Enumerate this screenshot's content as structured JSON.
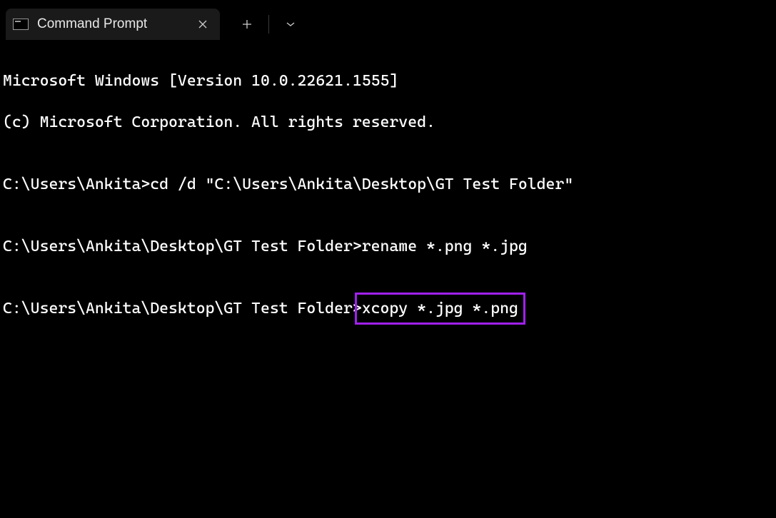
{
  "tab": {
    "title": "Command Prompt"
  },
  "terminal": {
    "line1": "Microsoft Windows [Version 10.0.22621.1555]",
    "line2": "(c) Microsoft Corporation. All rights reserved.",
    "line3": "",
    "line4_prompt": "C:\\Users\\Ankita>",
    "line4_cmd": "cd /d \"C:\\Users\\Ankita\\Desktop\\GT Test Folder\"",
    "line5": "",
    "line6_prompt": "C:\\Users\\Ankita\\Desktop\\GT Test Folder>",
    "line6_cmd": "rename *.png *.jpg",
    "line7": "",
    "line8_prompt": "C:\\Users\\Ankita\\Desktop\\GT Test Folder>",
    "line8_cmd": "xcopy *.jpg *.png"
  },
  "highlight": {
    "color": "#a020f0"
  }
}
